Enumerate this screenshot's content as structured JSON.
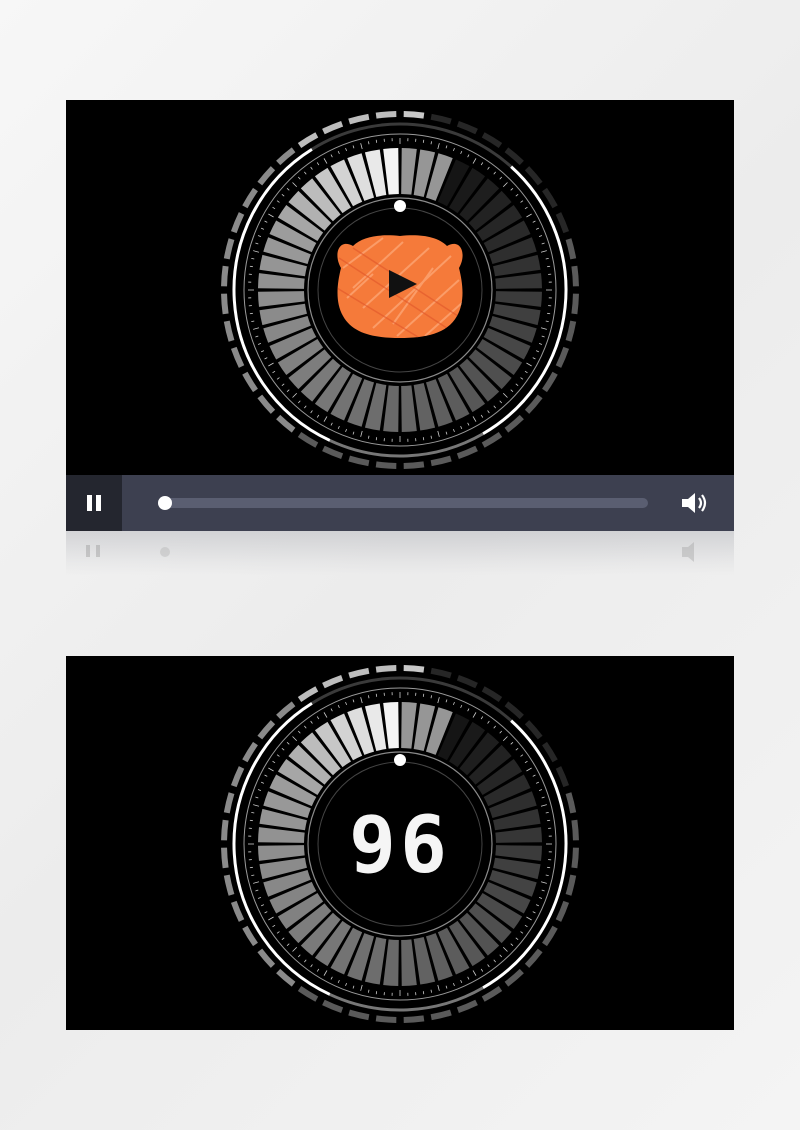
{
  "player": {
    "progress": 0.0,
    "state": "playing",
    "logo_icon": "orange-bear-play-logo",
    "controls": {
      "pause_icon": "pause-icon",
      "volume_icon": "volume-icon"
    }
  },
  "countdown": {
    "value": "96"
  },
  "colors": {
    "background": "#f2f2f2",
    "panel": "#000000",
    "control_bar": "#3d4050",
    "pause_area": "#24262f",
    "track": "#5a5e71",
    "accent_orange": "#f57a3a",
    "white": "#ffffff"
  }
}
